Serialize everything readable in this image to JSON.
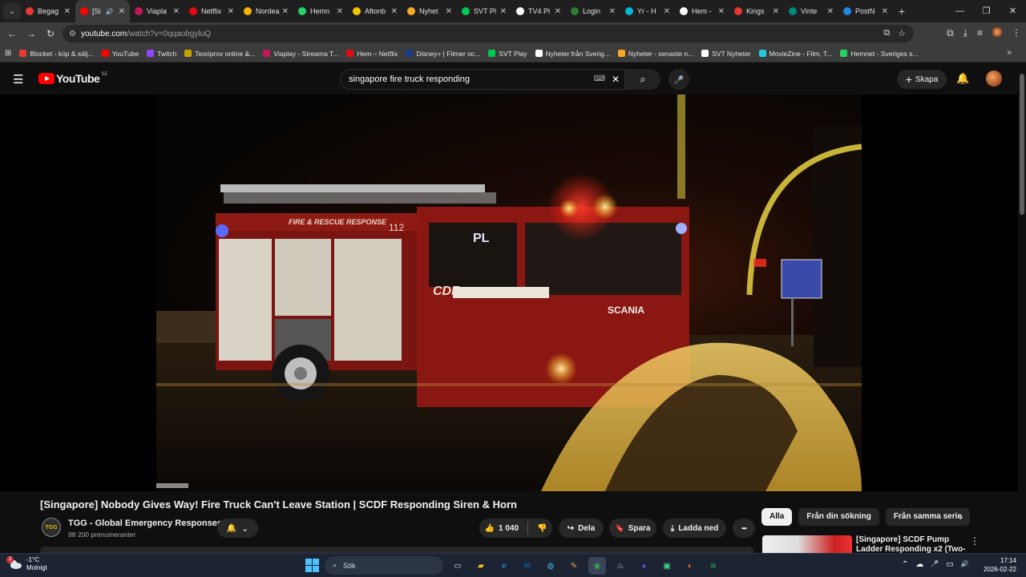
{
  "browser": {
    "tabs": [
      {
        "label": "Begag",
        "color": "#e53935",
        "active": false
      },
      {
        "label": "[Si",
        "color": "#ff0000",
        "active": true,
        "audio": "🔊"
      },
      {
        "label": "Viapla",
        "color": "#c2185b",
        "active": false
      },
      {
        "label": "Netflix",
        "color": "#e50914",
        "active": false
      },
      {
        "label": "Nordea",
        "color": "#f5b400",
        "active": false
      },
      {
        "label": "Hemn",
        "color": "#25d366",
        "active": false
      },
      {
        "label": "Aftonb",
        "color": "#f5c400",
        "active": false
      },
      {
        "label": "Nyhet",
        "color": "#f9a825",
        "active": false
      },
      {
        "label": "SVT Pl",
        "color": "#00c853",
        "active": false
      },
      {
        "label": "TV4 Pl",
        "color": "#ffffff",
        "active": false
      },
      {
        "label": "Login",
        "color": "#2e7d32",
        "active": false
      },
      {
        "label": "Yr - H",
        "color": "#00b8d4",
        "active": false
      },
      {
        "label": "Hem -",
        "color": "#ffffff",
        "active": false
      },
      {
        "label": "Kings",
        "color": "#e53935",
        "active": false
      },
      {
        "label": "Vinte",
        "color": "#00897b",
        "active": false
      },
      {
        "label": "PostN",
        "color": "#1e88e5",
        "active": false
      }
    ],
    "tab_close": "✕",
    "new_tab": "+",
    "window_controls": {
      "minimize": "—",
      "restore": "❐",
      "close": "✕"
    },
    "nav": {
      "back": "←",
      "forward": "→",
      "reload": "↻"
    },
    "url": {
      "domain": "youtube.com",
      "path": "/watch?v=0qqaobgyluQ",
      "site_info_icon": "⚙"
    },
    "omnibox_icons": [
      "⧉",
      "☆"
    ],
    "toolbar_icons": [
      "⧉",
      "⤓",
      "≡",
      "⋮"
    ],
    "bookmarks": [
      {
        "label": "Blocket - köp & sälj...",
        "color": "#e53935"
      },
      {
        "label": "YouTube",
        "color": "#ff0000"
      },
      {
        "label": "Twitch",
        "color": "#9146ff"
      },
      {
        "label": "Teoriprov online &...",
        "color": "#c8a000"
      },
      {
        "label": "Viaplay - Streama T...",
        "color": "#c2185b"
      },
      {
        "label": "Hem – Netflix",
        "color": "#e50914"
      },
      {
        "label": "Disney+ | Filmer oc...",
        "color": "#1a3a8f"
      },
      {
        "label": "SVT Play",
        "color": "#00c853"
      },
      {
        "label": "Nyheter från Sverig...",
        "color": "#ffffff"
      },
      {
        "label": "Nyheter - senaste n...",
        "color": "#f9a825"
      },
      {
        "label": "SVT Nyheter",
        "color": "#ffffff"
      },
      {
        "label": "MovieZine - Film, T...",
        "color": "#26c6da"
      },
      {
        "label": "Hemnet - Sveriges s...",
        "color": "#25d366"
      }
    ],
    "bookmarks_more": "»",
    "apps_glyph": "⊞"
  },
  "youtube": {
    "logo_text": "YouTube",
    "country_code": "SE",
    "search_value": "singapore fire truck responding",
    "keyboard_glyph": "⌨",
    "clear_glyph": "✕",
    "search_glyph": "⌕",
    "mic_glyph": "🎤",
    "menu_glyph": "☰",
    "create_label": "Skapa",
    "create_glyph": "+",
    "bell_glyph": "🔔",
    "video": {
      "title": "[Singapore] Nobody Gives Way! Fire Truck Can't Leave Station | SCDF Responding Siren & Horn",
      "truck_side_text": "FIRE & RESCUE RESPONSE",
      "truck_number": "112",
      "truck_brand": "SCANIA",
      "truck_cab_text": "PL",
      "truck_door_text": "CDF"
    },
    "channel": {
      "avatar_text": "TGG",
      "name": "TGG - Global Emergency Responses",
      "subscribers": "98 200 prenumeranter"
    },
    "actions": {
      "likes": "1 040",
      "share": "Dela",
      "save": "Spara",
      "download": "Ladda ned",
      "like_glyph": "👍",
      "dislike_glyph": "👎",
      "share_glyph": "↪",
      "save_glyph": "🔖",
      "download_glyph": "⤓",
      "more_glyph": "•••",
      "subscribe_bell_glyph": "🔔",
      "subscribe_chevron": "⌄"
    },
    "chips": [
      "Alla",
      "Från din sökning",
      "Från samma serie"
    ],
    "chip_next": "›",
    "recommendation": {
      "title": "[Singapore] SCDF Pump Ladder Responding x2 (Two-Tone",
      "more": "⋮"
    }
  },
  "taskbar": {
    "weather_temp": "-1°C",
    "weather_desc": "Molnigt",
    "weather_badge": "2",
    "search_label": "Sök",
    "search_glyph": "⌕",
    "apps": [
      {
        "name": "task-view",
        "glyph": "▭",
        "color": "#cfd8dc"
      },
      {
        "name": "file-explorer",
        "glyph": "▰",
        "color": "#f5c518"
      },
      {
        "name": "edge",
        "glyph": "e",
        "color": "#1ba1e2"
      },
      {
        "name": "outlook",
        "glyph": "✉",
        "color": "#0f6cbd"
      },
      {
        "name": "copilot",
        "glyph": "◍",
        "color": "#3fb6e8"
      },
      {
        "name": "terminal",
        "glyph": "✎",
        "color": "#e8a050"
      },
      {
        "name": "chrome",
        "glyph": "◉",
        "color": "#34a853"
      },
      {
        "name": "steam",
        "glyph": "♨",
        "color": "#c7d5e0"
      },
      {
        "name": "discord",
        "glyph": "◕",
        "color": "#5865f2"
      },
      {
        "name": "android",
        "glyph": "▣",
        "color": "#3ddc84"
      },
      {
        "name": "firefox",
        "glyph": "◐",
        "color": "#ff7139"
      },
      {
        "name": "spotify",
        "glyph": "≋",
        "color": "#1db954"
      }
    ],
    "tray": [
      "⌃",
      "☁",
      "🎤",
      "▭",
      "🔊"
    ],
    "time": "17:14",
    "date": "2026-02-22"
  }
}
